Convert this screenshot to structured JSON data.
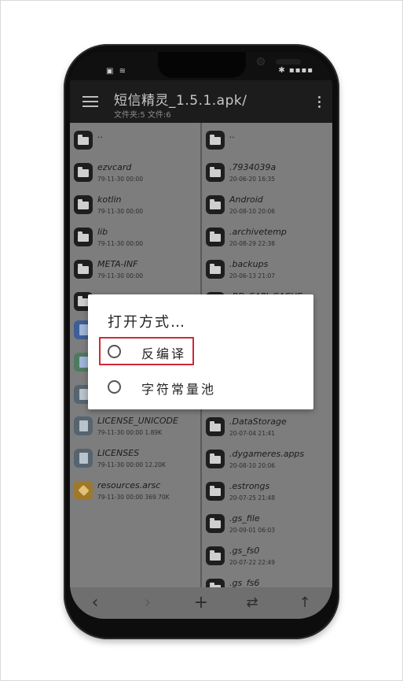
{
  "app": {
    "title": "短信精灵_1.5.1.apk/",
    "subtitle": "文件夹:5  文件:6"
  },
  "status": {
    "left_icons": "▣ ≋",
    "right_icons": "✱ ▪▪▪▪"
  },
  "left_pane": {
    "items": [
      {
        "name": "..",
        "meta": "",
        "icon": "folder-icon"
      },
      {
        "name": "ezvcard",
        "meta": "79-11-30 00:00",
        "icon": "folder-icon"
      },
      {
        "name": "kotlin",
        "meta": "79-11-30 00:00",
        "icon": "folder-icon"
      },
      {
        "name": "lib",
        "meta": "79-11-30 00:00",
        "icon": "folder-icon"
      },
      {
        "name": "META-INF",
        "meta": "79-11-30 00:00",
        "icon": "folder-icon"
      },
      {
        "name": "",
        "meta": "",
        "icon": "folder-icon"
      },
      {
        "name": "",
        "meta": "",
        "icon": "dex-file-icon"
      },
      {
        "name": "",
        "meta": "",
        "icon": "dex-file-icon"
      },
      {
        "name": "",
        "meta": "",
        "icon": "file-icon"
      },
      {
        "name": "LICENSE_UNICODE",
        "meta": "79-11-30 00:00  1.89K",
        "icon": "file-icon"
      },
      {
        "name": "LICENSES",
        "meta": "79-11-30 00:00  12.20K",
        "icon": "file-icon"
      },
      {
        "name": "resources.arsc",
        "meta": "79-11-30 00:00  369.70K",
        "icon": "resources-icon"
      }
    ]
  },
  "right_pane": {
    "items": [
      {
        "name": "..",
        "meta": "",
        "icon": "folder-icon"
      },
      {
        "name": ".7934039a",
        "meta": "20-06-20 16:35",
        "icon": "folder-icon"
      },
      {
        "name": "Android",
        "meta": "20-08-10 20:06",
        "icon": "folder-icon"
      },
      {
        "name": ".archivetemp",
        "meta": "20-08-29 22:38",
        "icon": "folder-icon"
      },
      {
        "name": ".backups",
        "meta": "20-06-13 21:07",
        "icon": "folder-icon"
      },
      {
        "name": ".BD_SAPI_CACHE",
        "meta": "",
        "icon": "folder-icon"
      },
      {
        "name": "",
        "meta": "",
        "icon": "folder-icon"
      },
      {
        "name": "",
        "meta": "",
        "icon": "folder-icon"
      },
      {
        "name": "",
        "meta": "",
        "icon": "folder-icon"
      },
      {
        "name": ".DataStorage",
        "meta": "20-07-04 21:41",
        "icon": "folder-icon"
      },
      {
        "name": ".dygameres.apps",
        "meta": "20-08-10 20:06",
        "icon": "folder-icon"
      },
      {
        "name": ".estrongs",
        "meta": "20-07-25 21:48",
        "icon": "folder-icon"
      },
      {
        "name": ".gs_file",
        "meta": "20-09-01 06:03",
        "icon": "folder-icon"
      },
      {
        "name": ".gs_fs0",
        "meta": "20-07-22 22:49",
        "icon": "folder-icon"
      },
      {
        "name": ".gs_fs6",
        "meta": "",
        "icon": "folder-icon"
      }
    ]
  },
  "bottom_nav": {
    "back": "‹",
    "forward": "›",
    "add": "+",
    "swap": "⇄",
    "up": "↑"
  },
  "dialog": {
    "title": "打开方式…",
    "options": [
      {
        "label": "反编译",
        "selected": false
      },
      {
        "label": "字符常量池",
        "selected": false
      }
    ]
  },
  "colors": {
    "highlight": "#d0283a",
    "dialog_bg": "#ffffff",
    "overlay": "#7a7a7a"
  }
}
